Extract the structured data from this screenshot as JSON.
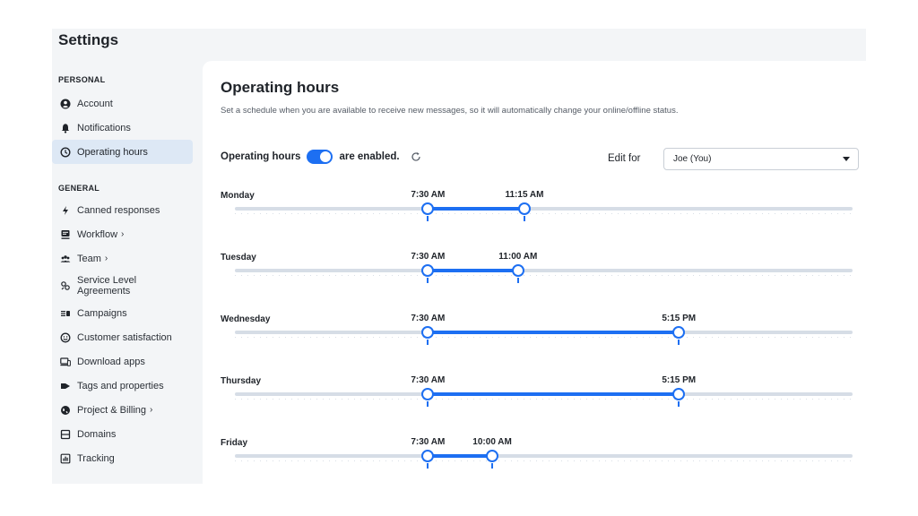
{
  "app": {
    "title": "Settings"
  },
  "sidebar": {
    "personal_label": "PERSONAL",
    "general_label": "GENERAL",
    "personal_items": [
      {
        "label": "Account",
        "icon": "account-icon"
      },
      {
        "label": "Notifications",
        "icon": "bell-icon"
      },
      {
        "label": "Operating hours",
        "icon": "clock-icon",
        "active": true
      }
    ],
    "general_items": [
      {
        "label": "Canned responses",
        "icon": "bolt-icon"
      },
      {
        "label": "Workflow",
        "icon": "workflow-icon",
        "chevron": "›"
      },
      {
        "label": "Team",
        "icon": "team-icon",
        "chevron": "›"
      },
      {
        "label": "Service Level Agreements",
        "icon": "sla-icon"
      },
      {
        "label": "Campaigns",
        "icon": "campaigns-icon"
      },
      {
        "label": "Customer satisfaction",
        "icon": "smiley-icon"
      },
      {
        "label": "Download apps",
        "icon": "devices-icon"
      },
      {
        "label": "Tags and properties",
        "icon": "tag-icon"
      },
      {
        "label": "Project & Billing",
        "icon": "globe-icon",
        "chevron": "›"
      },
      {
        "label": "Domains",
        "icon": "domains-icon"
      },
      {
        "label": "Tracking",
        "icon": "tracking-icon"
      }
    ]
  },
  "main": {
    "title": "Operating hours",
    "description": "Set a schedule when you are available to receive new messages, so it will automatically change your online/offline status.",
    "toggle": {
      "prefix": "Operating hours",
      "suffix": "are enabled.",
      "enabled": true
    },
    "edit_for": {
      "label": "Edit for",
      "value": "Joe (You)"
    },
    "days": [
      {
        "name": "Monday",
        "start": "7:30 AM",
        "end": "11:15 AM",
        "start_hour": 7.5,
        "end_hour": 11.25
      },
      {
        "name": "Tuesday",
        "start": "7:30 AM",
        "end": "11:00 AM",
        "start_hour": 7.5,
        "end_hour": 11.0
      },
      {
        "name": "Wednesday",
        "start": "7:30 AM",
        "end": "5:15 PM",
        "start_hour": 7.5,
        "end_hour": 17.25
      },
      {
        "name": "Thursday",
        "start": "7:30 AM",
        "end": "5:15 PM",
        "start_hour": 7.5,
        "end_hour": 17.25
      },
      {
        "name": "Friday",
        "start": "7:30 AM",
        "end": "10:00 AM",
        "start_hour": 7.5,
        "end_hour": 10.0
      }
    ]
  },
  "colors": {
    "accent": "#1d6ff2",
    "track": "#d6dde6",
    "active_nav": "#dde8f5",
    "app_bg": "#f3f5f7"
  }
}
